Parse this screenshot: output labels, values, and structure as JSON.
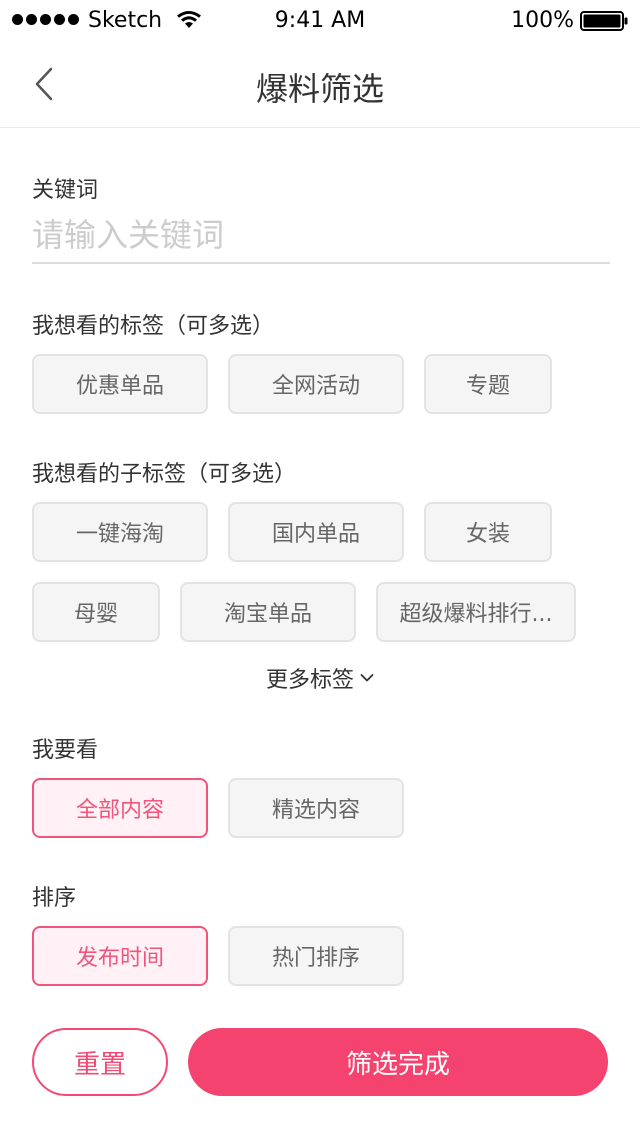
{
  "status_bar": {
    "carrier": "Sketch",
    "time": "9:41 AM",
    "battery": "100%"
  },
  "nav": {
    "title": "爆料筛选",
    "back_icon": "chevron-left-icon"
  },
  "keyword": {
    "label": "关键词",
    "placeholder": "请输入关键词"
  },
  "tags": {
    "label": "我想看的标签（可多选）",
    "items": [
      "优惠单品",
      "全网活动",
      "专题"
    ]
  },
  "sub_tags": {
    "label": "我想看的子标签（可多选）",
    "items": [
      "一键海淘",
      "国内单品",
      "女装",
      "母婴",
      "淘宝单品",
      "超级爆料排行..."
    ]
  },
  "more": {
    "label": "更多标签",
    "icon": "chevron-down-icon"
  },
  "view": {
    "label": "我要看",
    "options": [
      "全部内容",
      "精选内容"
    ],
    "selected": "全部内容"
  },
  "sort": {
    "label": "排序",
    "options": [
      "发布时间",
      "热门排序"
    ],
    "selected": "发布时间"
  },
  "actions": {
    "reset": "重置",
    "done": "筛选完成"
  },
  "colors": {
    "accent": "#f4436e",
    "chip_bg": "#f5f5f5",
    "chip_border": "#e3e3e3",
    "active_bg": "#fff1f5"
  }
}
